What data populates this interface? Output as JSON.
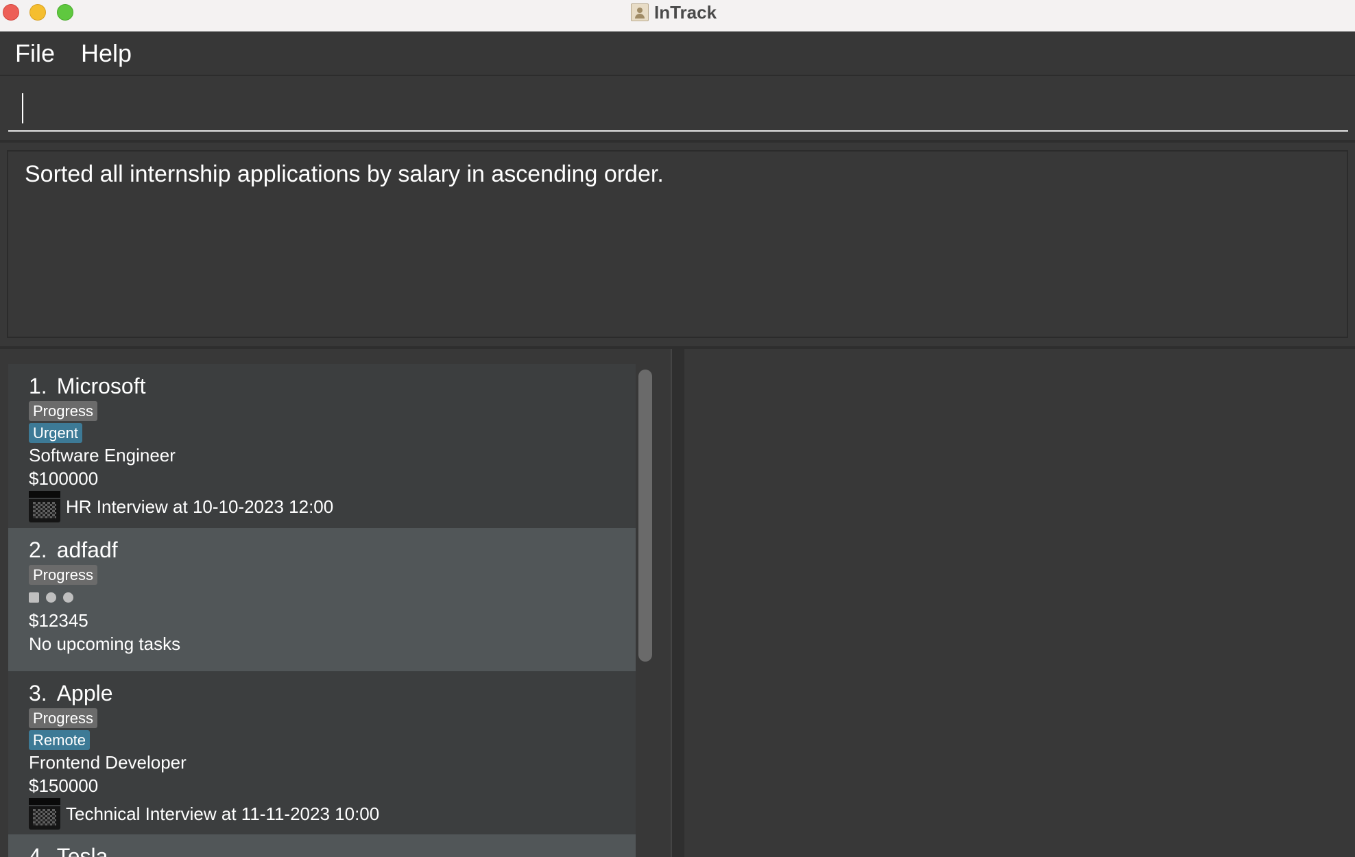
{
  "window": {
    "title": "InTrack"
  },
  "menu": {
    "file": "File",
    "help": "Help"
  },
  "command": {
    "value": "",
    "placeholder": ""
  },
  "result": {
    "message": "Sorted all internship applications by salary in ascending order."
  },
  "applications": [
    {
      "index": "1.",
      "company": "Microsoft",
      "status": "Progress",
      "tag": "Urgent",
      "role": "Software Engineer",
      "salary": "$100000",
      "task": "HR Interview at 10-10-2023 12:00"
    },
    {
      "index": "2.",
      "company": "adfadf",
      "status": "Progress",
      "salary": "$12345",
      "task": "No upcoming tasks"
    },
    {
      "index": "3.",
      "company": "Apple",
      "status": "Progress",
      "tag": "Remote",
      "role": "Frontend Developer",
      "salary": "$150000",
      "task": "Technical Interview at 11-11-2023 10:00"
    },
    {
      "index": "4.",
      "company": "Tesla"
    }
  ],
  "colors": {
    "background": "#383838",
    "card": "#3c3e3f",
    "card_selected": "#515658",
    "status_tag": "#6b6b6b",
    "label_tag": "#3d7a96"
  }
}
